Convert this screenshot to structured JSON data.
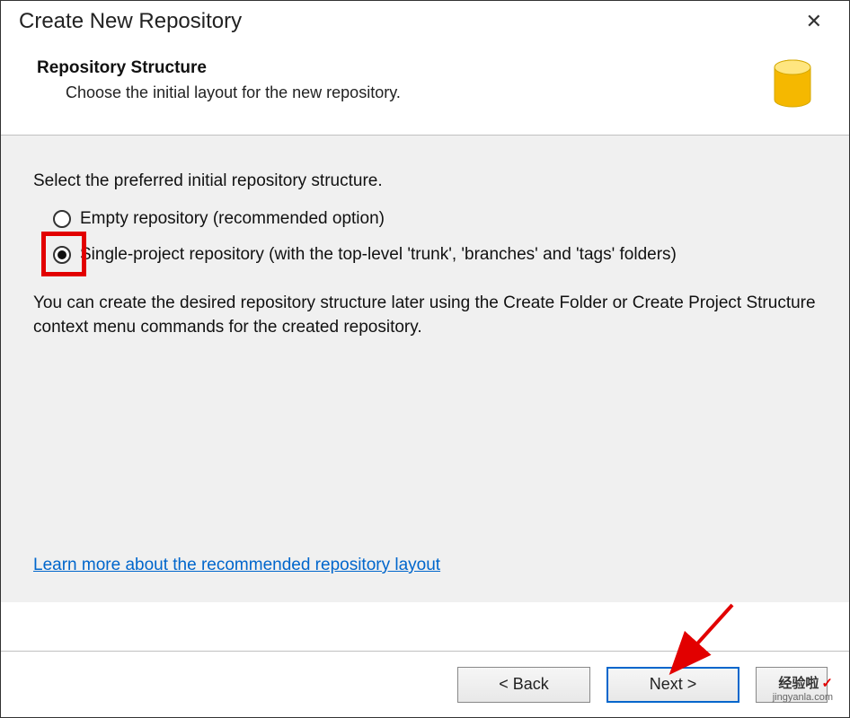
{
  "titleBar": {
    "title": "Create New Repository"
  },
  "header": {
    "title": "Repository Structure",
    "subtitle": "Choose the initial layout for the new repository."
  },
  "main": {
    "prompt": "Select the preferred initial repository structure.",
    "options": {
      "empty": "Empty repository (recommended option)",
      "single": "Single-project repository (with the top-level 'trunk', 'branches' and 'tags' folders)"
    },
    "info": "You can create the desired repository structure later using the Create Folder or Create Project Structure context menu commands for the created repository.",
    "link": "Learn more about the recommended repository layout"
  },
  "buttons": {
    "back": "< Back",
    "next": "Next >",
    "cancel": "Cancel"
  },
  "watermark": {
    "title": "经验啦",
    "url": "jingyanla.com"
  }
}
